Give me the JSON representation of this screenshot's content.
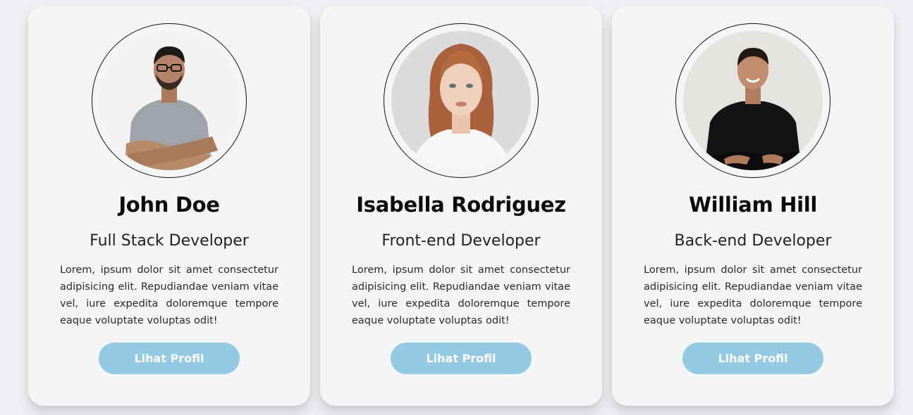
{
  "cards": [
    {
      "name": "John Doe",
      "role": "Full Stack Developer",
      "description": "Lorem, ipsum dolor sit amet consectetur adipisicing elit. Repudiandae veniam vitae vel, iure expedita doloremque tempore eaque voluptate voluptas odit!",
      "button_label": "Lihat Profil"
    },
    {
      "name": "Isabella Rodriguez",
      "role": "Front-end Developer",
      "description": "Lorem, ipsum dolor sit amet consectetur adipisicing elit. Repudiandae veniam vitae vel, iure expedita doloremque tempore eaque voluptate voluptas odit!",
      "button_label": "Lihat Profil"
    },
    {
      "name": "William Hill",
      "role": "Back-end Developer",
      "description": "Lorem, ipsum dolor sit amet consectetur adipisicing elit. Repudiandae veniam vitae vel, iure expedita doloremque tempore eaque voluptate voluptas odit!",
      "button_label": "Lihat Profil"
    }
  ],
  "colors": {
    "page_background": "#eef0f4",
    "card_background": "#f4f5f5",
    "button_background": "#93c9e3",
    "button_text": "#ffffff"
  }
}
